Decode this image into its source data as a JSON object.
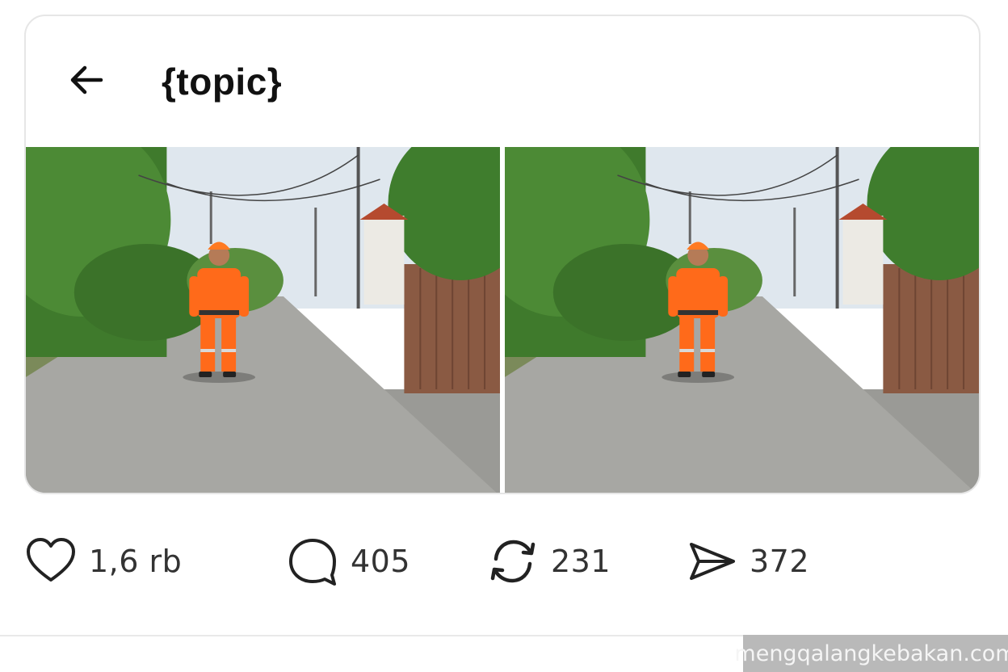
{
  "post": {
    "title": "{topic}",
    "back_icon": "arrow-left-icon",
    "photos": [
      {
        "alt": "worker-in-orange-uniform-on-street"
      },
      {
        "alt": "worker-in-orange-uniform-on-street"
      }
    ]
  },
  "actions": {
    "like": {
      "icon": "heart-icon",
      "count": "1,6 rb"
    },
    "comment": {
      "icon": "comment-bubble-icon",
      "count": "405"
    },
    "repost": {
      "icon": "repost-icon",
      "count": "231"
    },
    "share": {
      "icon": "send-icon",
      "count": "372"
    }
  },
  "watermark": "mengqalangkebakan.com",
  "colors": {
    "accent_uniform": "#ff6a1a",
    "icon": "#222222",
    "text_count": "#333333",
    "card_border": "#e6e6e6"
  }
}
